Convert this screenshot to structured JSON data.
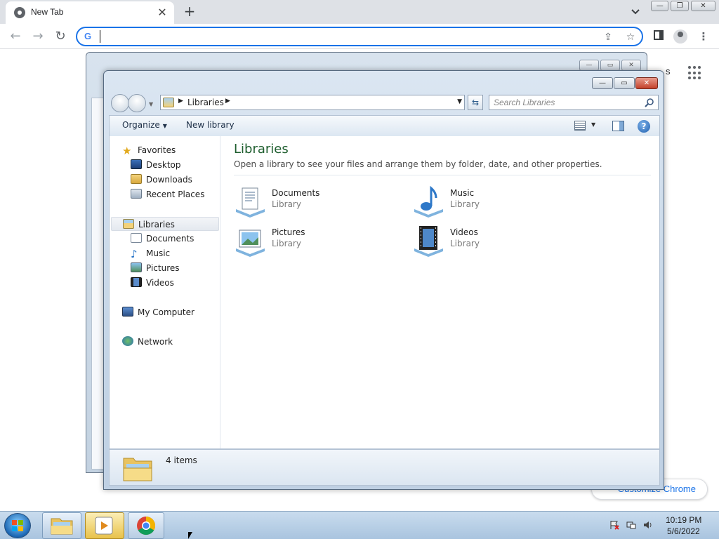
{
  "browser": {
    "tab_title": "New Tab",
    "tab_close": "✕",
    "new_tab": "+",
    "address_placeholder": "",
    "customize_label": "Customize Chrome",
    "ntp_fragment": "s"
  },
  "explorer": {
    "address_path": "Libraries",
    "search_placeholder": "Search Libraries",
    "toolbar": {
      "organize": "Organize",
      "new_library": "New library"
    },
    "nav": {
      "favorites": "Favorites",
      "desktop": "Desktop",
      "downloads": "Downloads",
      "recent_places": "Recent Places",
      "libraries": "Libraries",
      "documents": "Documents",
      "music": "Music",
      "pictures": "Pictures",
      "videos": "Videos",
      "my_computer": "My Computer",
      "network": "Network"
    },
    "content": {
      "heading": "Libraries",
      "description": "Open a library to see your files and arrange them by folder, date, and other properties.",
      "items": [
        {
          "name": "Documents",
          "type": "Library",
          "icon": "documents-library-icon"
        },
        {
          "name": "Music",
          "type": "Library",
          "icon": "music-library-icon"
        },
        {
          "name": "Pictures",
          "type": "Library",
          "icon": "pictures-library-icon"
        },
        {
          "name": "Videos",
          "type": "Library",
          "icon": "videos-library-icon"
        }
      ]
    },
    "status": {
      "item_count": "4 items"
    }
  },
  "taskbar": {
    "time": "10:19 PM",
    "date": "5/6/2022"
  },
  "colors": {
    "chrome_accent": "#1a73e8",
    "libraries_heading": "#1e5e2e",
    "close_button": "#c4422b"
  }
}
